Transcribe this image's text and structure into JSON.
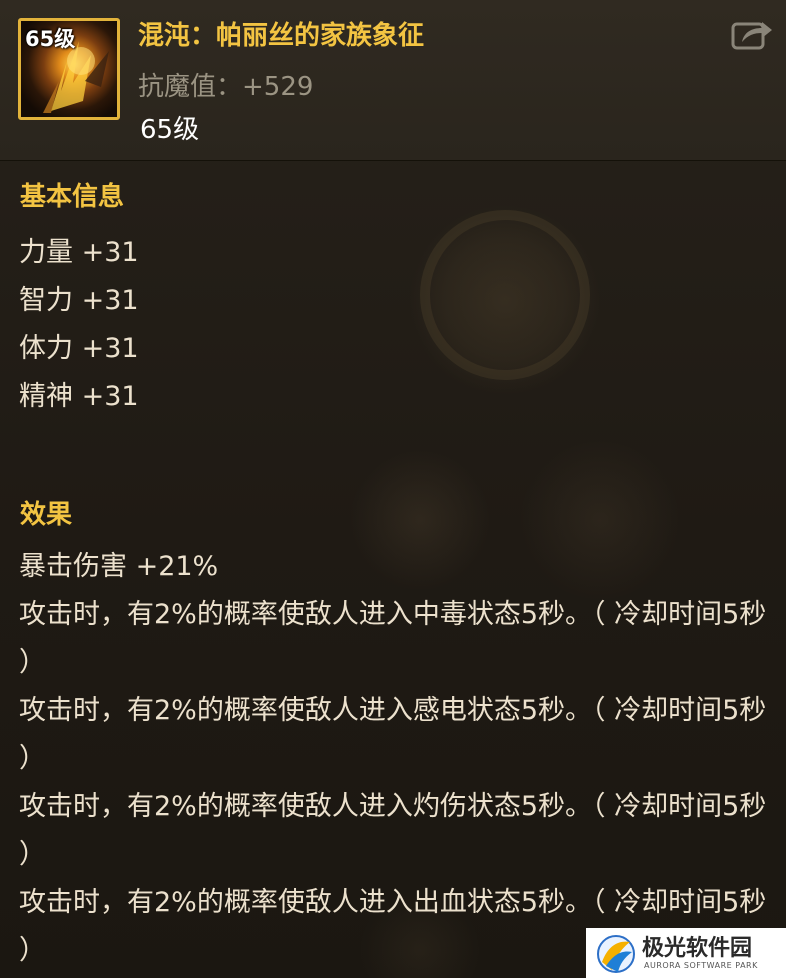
{
  "item": {
    "icon_level": "65级",
    "title": "混沌：帕丽丝的家族象征",
    "stat": "抗魔值：+529",
    "level": "65级",
    "share_icon": "share-icon"
  },
  "basic": {
    "title": "基本信息",
    "stats": [
      "力量 +31",
      "智力 +31",
      "体力 +31",
      "精神 +31"
    ]
  },
  "effects": {
    "title": "效果",
    "lines": [
      "暴击伤害 +21%",
      "攻击时，有2%的概率使敌人进入中毒状态5秒。（ 冷却时间5秒 ）",
      "攻击时，有2%的概率使敌人进入感电状态5秒。（ 冷却时间5秒 ）",
      "攻击时，有2%的概率使敌人进入灼伤状态5秒。（ 冷却时间5秒 ）",
      "攻击时，有2%的概率使敌人进入出血状态5秒。（ 冷却时间5秒 ）"
    ]
  },
  "watermark": {
    "name": "极光软件园",
    "sub": "AURORA SOFTWARE PARK"
  },
  "colors": {
    "title_gold": "#f3c442",
    "stat_gray": "#9b9483",
    "text": "#ece1cd",
    "frame_gold": "#e2b33b"
  }
}
